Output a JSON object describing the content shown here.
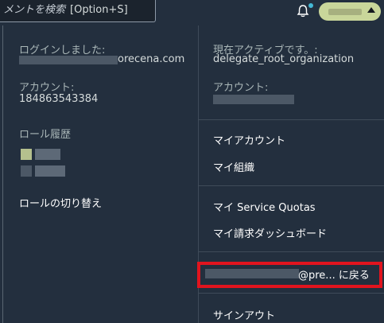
{
  "topbar": {
    "search_placeholder": "メントを検索",
    "search_shortcut": "[Option+S]"
  },
  "left": {
    "login_label": "ログインしました:",
    "login_value_suffix": "orecena.com",
    "account_label": "アカウント:",
    "account_id": "184863543384",
    "role_history_label": "ロール履歴",
    "switch_role": "ロールの切り替え"
  },
  "right": {
    "active_label": "現在アクティブです。:",
    "active_value": "delegate_root_organization",
    "account_label": "アカウント:",
    "menu": {
      "my_account": "マイアカウント",
      "my_org": "マイ組織",
      "my_quotas": "マイ Service Quotas",
      "my_billing": "マイ請求ダッシュボード",
      "return_to": "@pre... に戻る",
      "sign_out": "サインアウト"
    }
  },
  "colors": {
    "background": "#232f3e",
    "highlight": "#e1141e",
    "account_button": "#c9d69a",
    "notification_dot": "#44b9d6"
  }
}
